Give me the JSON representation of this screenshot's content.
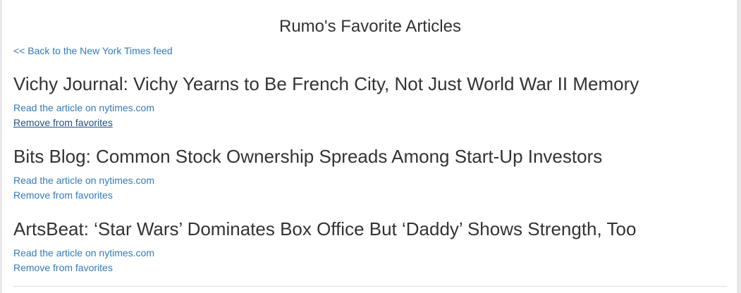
{
  "page_title": "Rumo's Favorite Articles",
  "back_link": "<< Back to the New York Times feed",
  "articles": [
    {
      "title": "Vichy Journal: Vichy Yearns to Be French City, Not Just World War II Memory",
      "read_link": "Read the article on nytimes.com",
      "remove_link": "Remove from favorites"
    },
    {
      "title": "Bits Blog: Common Stock Ownership Spreads Among Start-Up Investors",
      "read_link": "Read the article on nytimes.com",
      "remove_link": "Remove from favorites"
    },
    {
      "title": "ArtsBeat: ‘Star Wars’ Dominates Box Office But ‘Daddy’ Shows Strength, Too",
      "read_link": "Read the article on nytimes.com",
      "remove_link": "Remove from favorites"
    }
  ]
}
